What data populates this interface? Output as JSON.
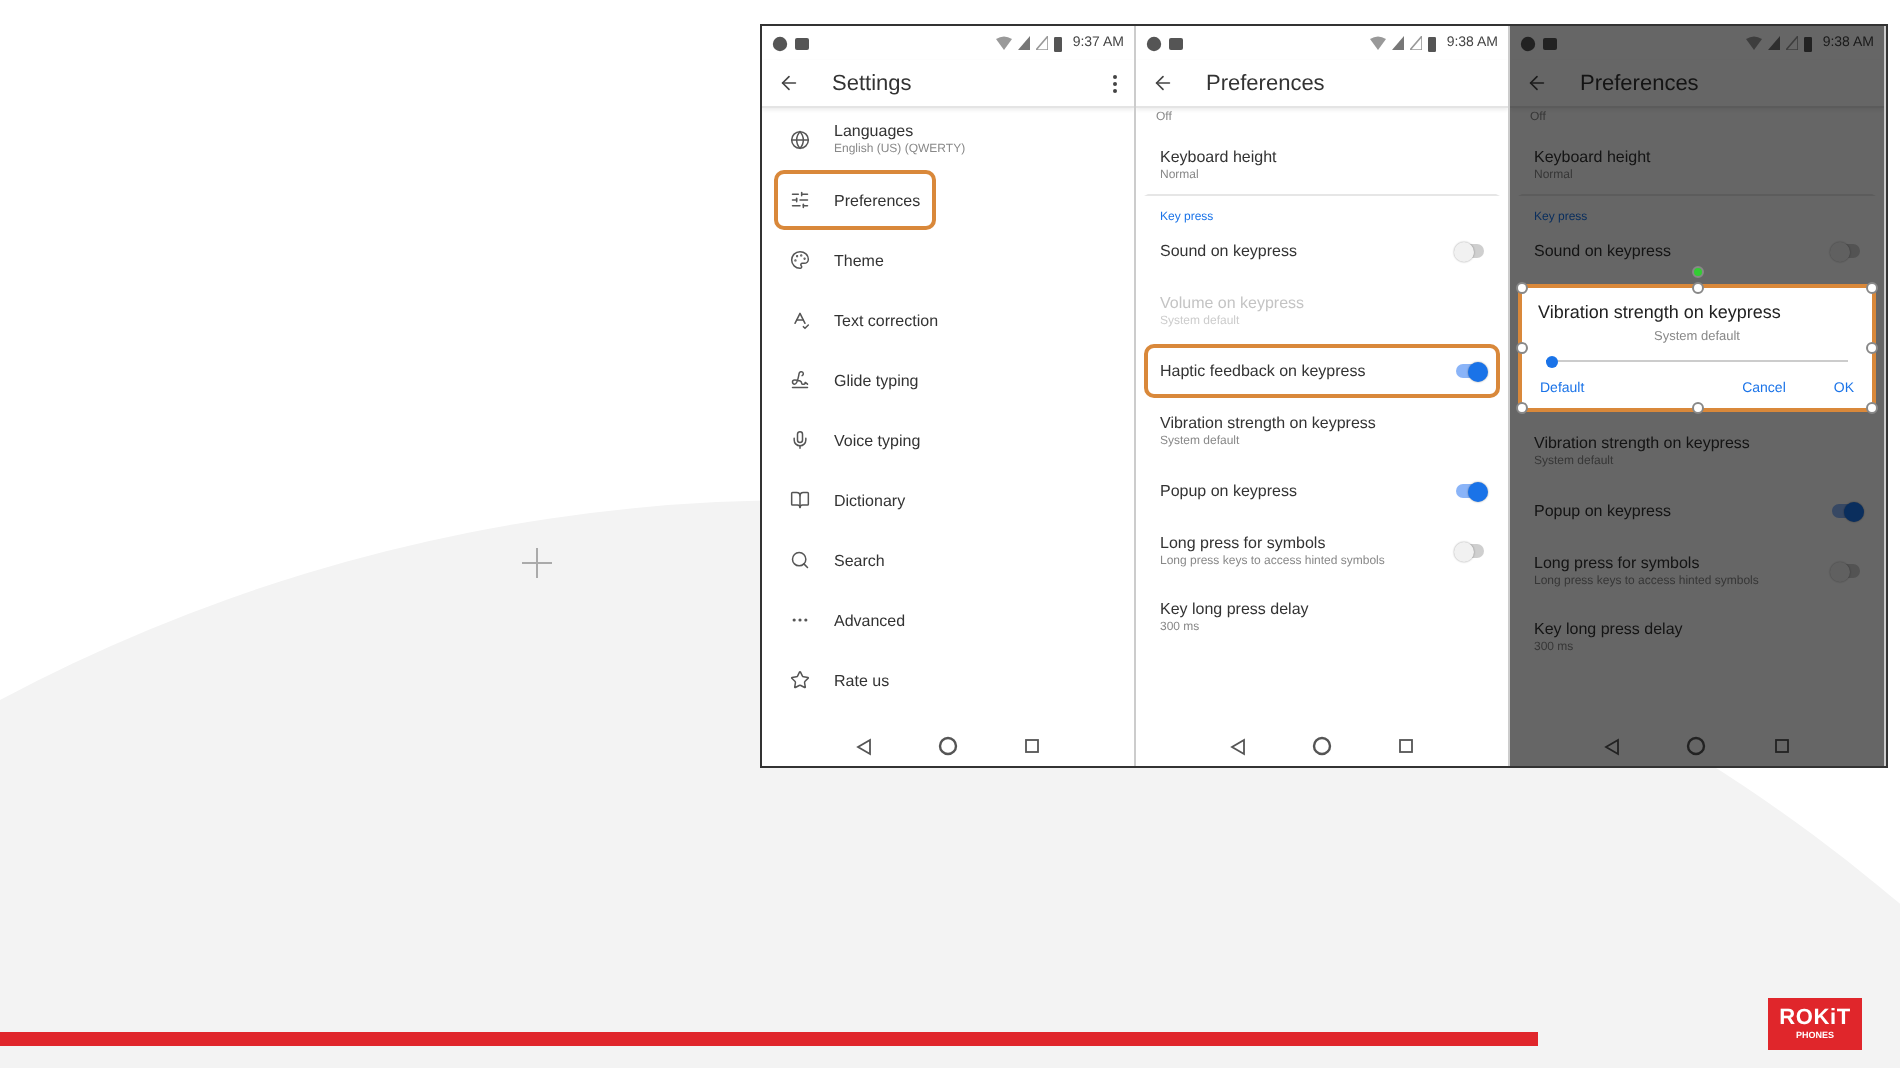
{
  "screens": [
    {
      "status_time": "9:37 AM",
      "dimmed": false,
      "title": "Settings",
      "menu": true,
      "items": [
        {
          "kind": "nav",
          "label": "Languages",
          "subtitle": "English (US) (QWERTY)",
          "highlighted": false
        },
        {
          "kind": "nav",
          "label": "Preferences",
          "highlighted": true
        },
        {
          "kind": "nav",
          "label": "Theme",
          "highlighted": false
        },
        {
          "kind": "nav",
          "label": "Text correction",
          "highlighted": false
        },
        {
          "kind": "nav",
          "label": "Glide typing",
          "highlighted": false
        },
        {
          "kind": "nav",
          "label": "Voice typing",
          "highlighted": false
        },
        {
          "kind": "nav",
          "label": "Dictionary",
          "highlighted": false
        },
        {
          "kind": "nav",
          "label": "Search",
          "highlighted": false
        },
        {
          "kind": "nav",
          "label": "Advanced",
          "highlighted": false
        },
        {
          "kind": "nav",
          "label": "Rate us",
          "highlighted": false
        }
      ]
    },
    {
      "status_time": "9:38 AM",
      "dimmed": false,
      "title": "Preferences",
      "menu": false,
      "items": [
        {
          "kind": "cut",
          "subtitle": "Off"
        },
        {
          "kind": "value",
          "label": "Keyboard height",
          "subtitle": "Normal",
          "disabled": false,
          "divider": true
        },
        {
          "kind": "header",
          "label": "Key press"
        },
        {
          "kind": "switch",
          "label": "Sound on keypress",
          "on": false,
          "highlighted": false
        },
        {
          "kind": "value",
          "label": "Volume on keypress",
          "subtitle": "System default",
          "disabled": true,
          "divider": false
        },
        {
          "kind": "switch",
          "label": "Haptic feedback on keypress",
          "on": true,
          "highlighted": true
        },
        {
          "kind": "value",
          "label": "Vibration strength on keypress",
          "subtitle": "System default",
          "disabled": false,
          "divider": false
        },
        {
          "kind": "switch",
          "label": "Popup on keypress",
          "on": true,
          "highlighted": false
        },
        {
          "kind": "switch",
          "label": "Long press for symbols",
          "subtitle": "Long press keys to access hinted symbols",
          "on": false,
          "highlighted": false
        },
        {
          "kind": "value",
          "label": "Key long press delay",
          "subtitle": "300 ms",
          "disabled": false,
          "divider": false
        }
      ]
    },
    {
      "status_time": "9:38 AM",
      "dimmed": true,
      "title": "Preferences",
      "menu": false,
      "items": [
        {
          "kind": "cut",
          "subtitle": "Off"
        },
        {
          "kind": "value",
          "label": "Keyboard height",
          "subtitle": "Normal",
          "disabled": false,
          "divider": true
        },
        {
          "kind": "header",
          "label": "Key press"
        },
        {
          "kind": "switch",
          "label": "Sound on keypress",
          "on": false,
          "highlighted": false
        },
        {
          "kind": "dialog",
          "title": "Vibration strength on keypress",
          "reading": "System default",
          "level": 0.02,
          "buttons": [
            "Default",
            "Cancel",
            "OK"
          ],
          "highlighted": true
        },
        {
          "kind": "value",
          "label": "Vibration strength on keypress",
          "subtitle": "System default",
          "disabled": false,
          "divider": false
        },
        {
          "kind": "switch",
          "label": "Popup on keypress",
          "on": true,
          "highlighted": false
        },
        {
          "kind": "switch",
          "label": "Long press for symbols",
          "subtitle": "Long press keys to access hinted symbols",
          "on": false,
          "highlighted": false
        },
        {
          "kind": "value",
          "label": "Key long press delay",
          "subtitle": "300 ms",
          "disabled": false,
          "divider": false
        }
      ]
    }
  ],
  "logo": {
    "name": "ROKiT",
    "tagline": "PHONES"
  }
}
